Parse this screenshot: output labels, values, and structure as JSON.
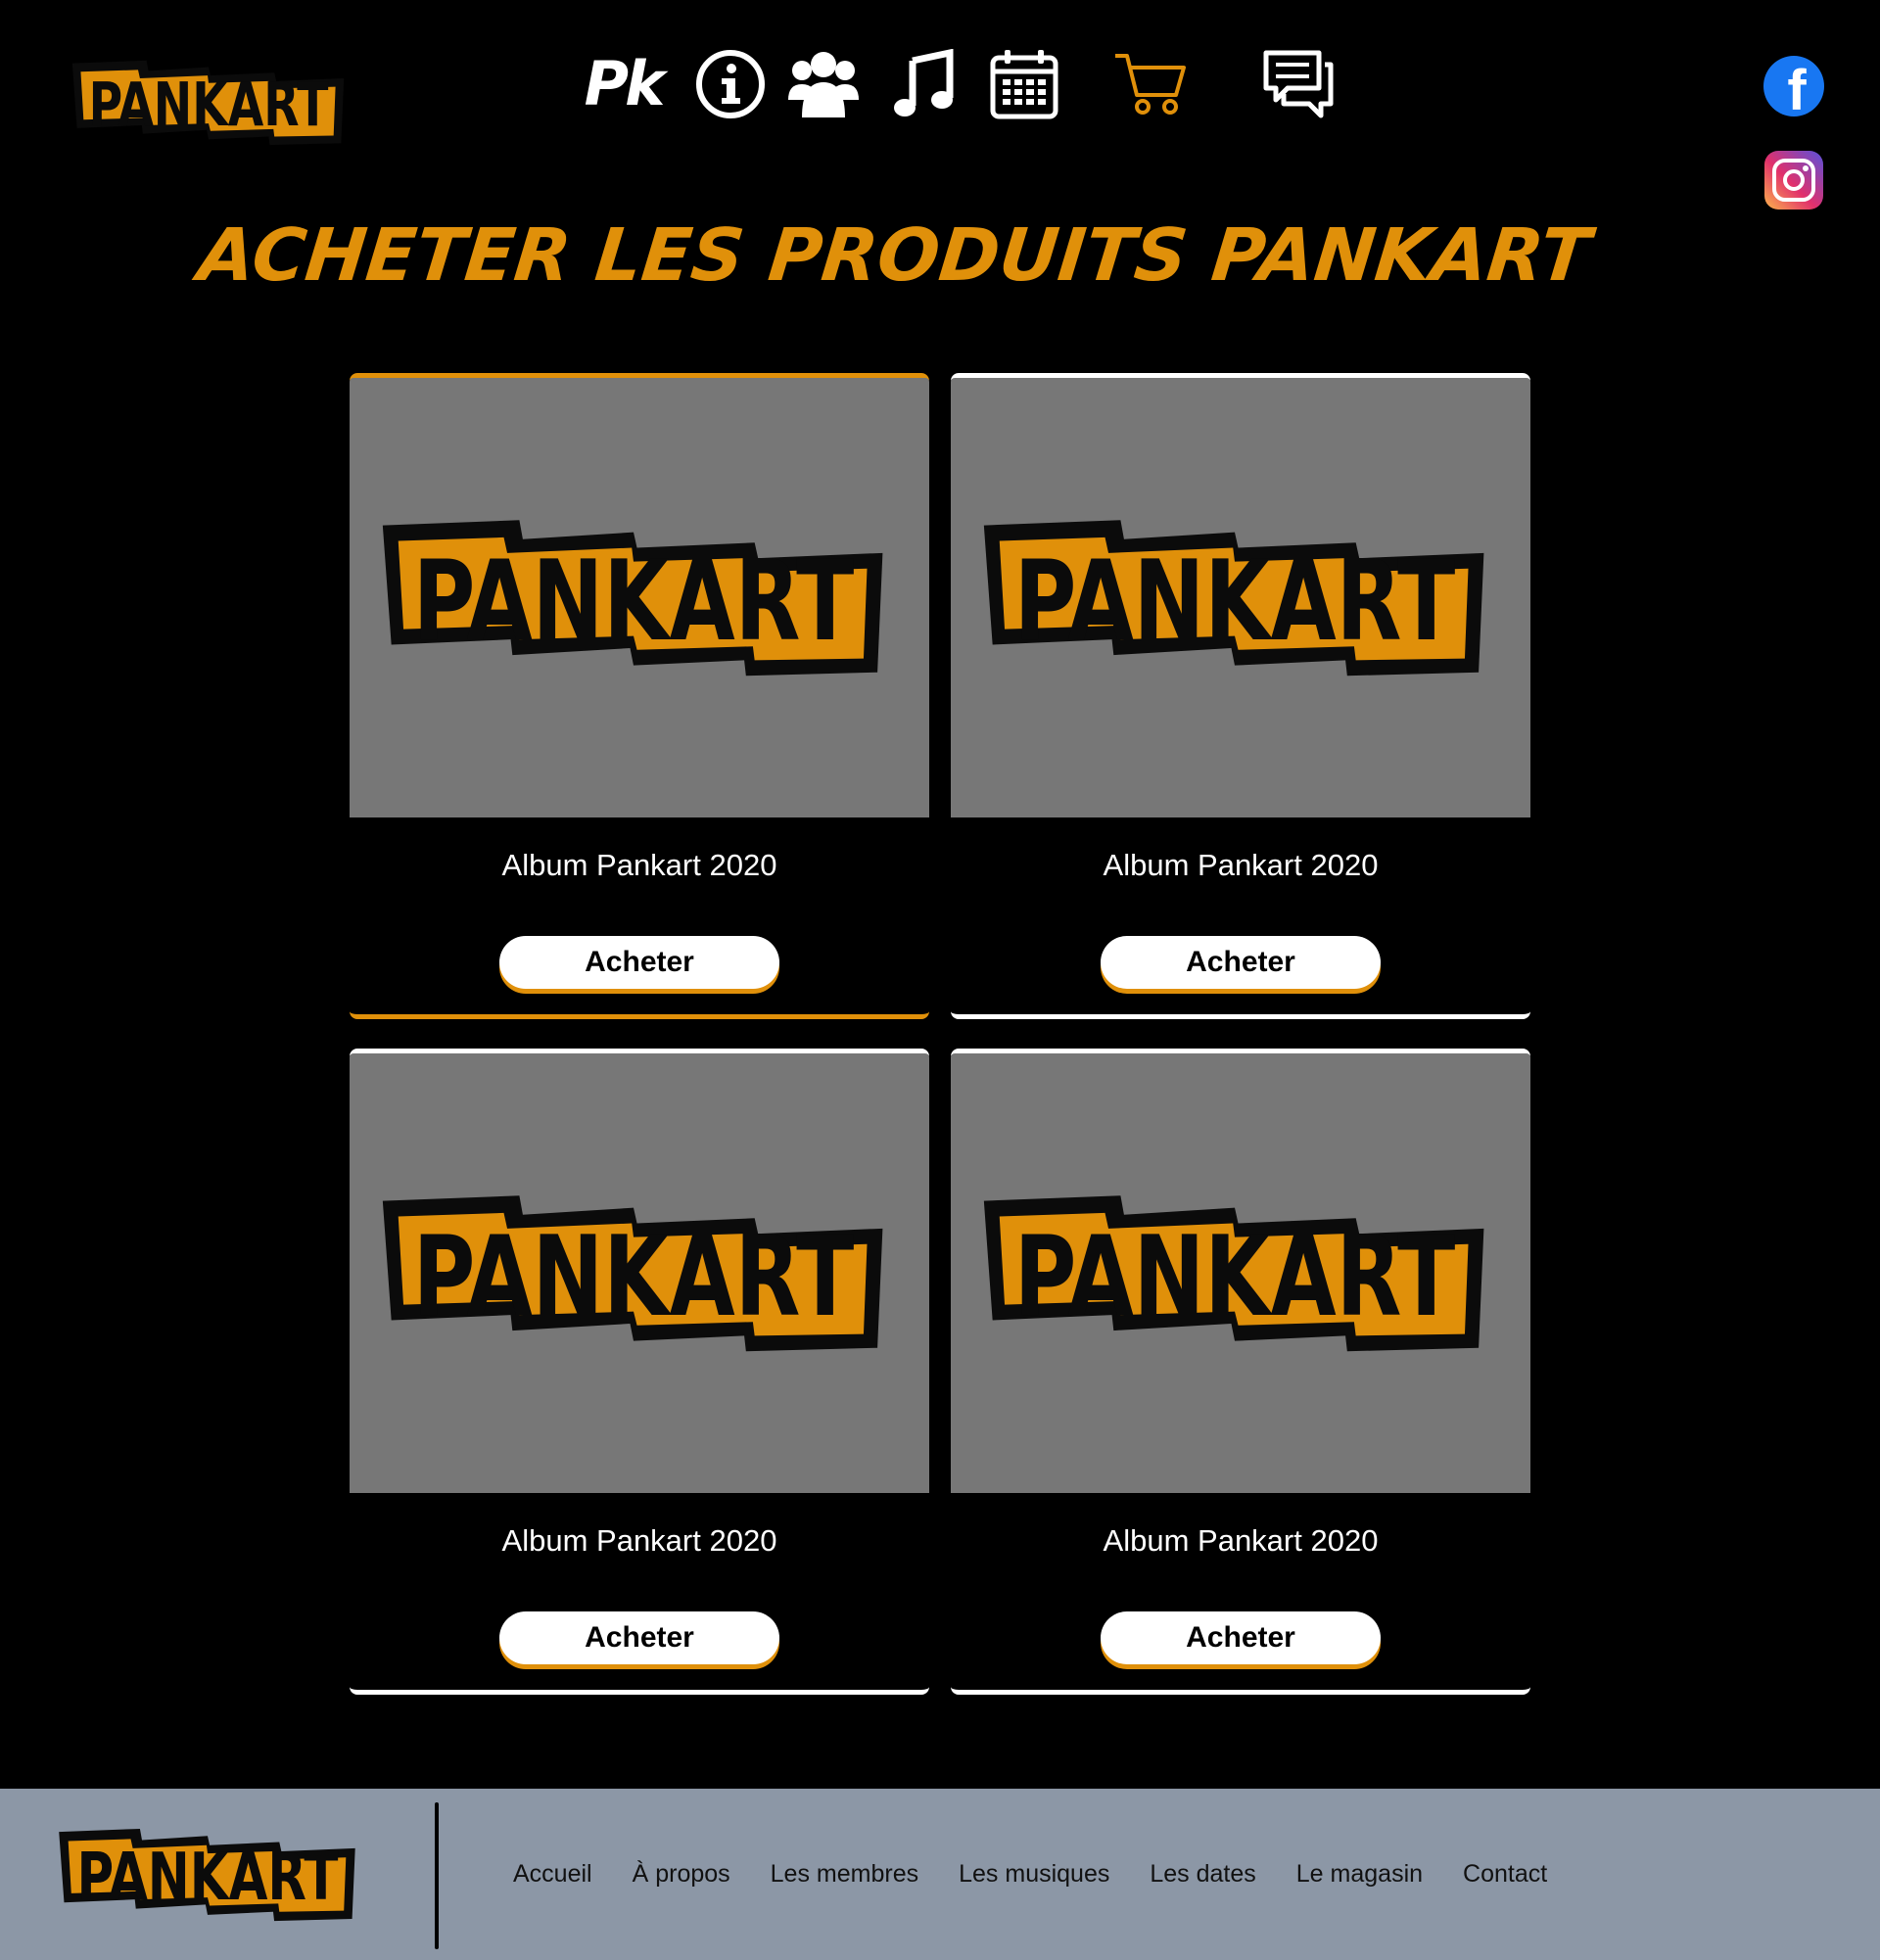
{
  "brand": {
    "name": "PANKART",
    "accent": "#e0900a",
    "logo_black": "#0b0b0b"
  },
  "header": {
    "nav": [
      {
        "id": "accueil",
        "icon": "pk-monogram-icon",
        "text": "Pk"
      },
      {
        "id": "a-propos",
        "icon": "info-icon"
      },
      {
        "id": "membres",
        "icon": "members-icon"
      },
      {
        "id": "musiques",
        "icon": "music-note-icon"
      },
      {
        "id": "dates",
        "icon": "calendar-icon"
      },
      {
        "id": "magasin",
        "icon": "cart-icon",
        "active": true
      },
      {
        "id": "contact",
        "icon": "chat-icon"
      }
    ],
    "social": [
      {
        "id": "facebook",
        "icon": "facebook-icon",
        "letter": "f",
        "color": "#1877f2"
      },
      {
        "id": "instagram",
        "icon": "instagram-icon"
      }
    ]
  },
  "main": {
    "title": "ACHETER LES PRODUITS PANKART",
    "products": [
      {
        "name": "Album Pankart 2020",
        "button": "Acheter",
        "highlighted": true
      },
      {
        "name": "Album Pankart 2020",
        "button": "Acheter",
        "highlighted": false
      },
      {
        "name": "Album Pankart 2020",
        "button": "Acheter",
        "highlighted": false
      },
      {
        "name": "Album Pankart 2020",
        "button": "Acheter",
        "highlighted": false
      }
    ]
  },
  "footer": {
    "links": [
      "Accueil",
      "À propos",
      "Les membres",
      "Les musiques",
      "Les dates",
      "Le magasin",
      "Contact"
    ],
    "background": "#8c97a6"
  }
}
